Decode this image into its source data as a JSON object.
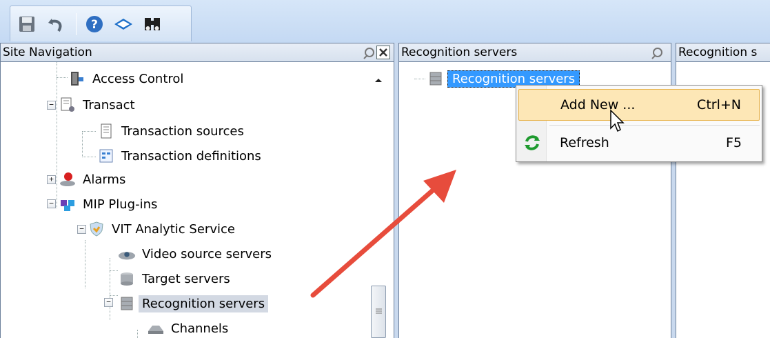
{
  "toolbar": {
    "buttons": [
      {
        "icon": "save-icon"
      },
      {
        "icon": "undo-icon"
      },
      {
        "icon": "help-icon"
      },
      {
        "icon": "book-icon"
      },
      {
        "icon": "binoculars-icon"
      }
    ]
  },
  "site_navigation": {
    "title": "Site Navigation",
    "tree": [
      {
        "label": "Access Control",
        "icon": "access-control-icon"
      },
      {
        "label": "Transact",
        "icon": "transact-icon",
        "expanded": true
      },
      {
        "label": "Transaction sources",
        "icon": "transaction-sources-icon"
      },
      {
        "label": "Transaction definitions",
        "icon": "transaction-definitions-icon"
      },
      {
        "label": "Alarms",
        "icon": "alarms-icon",
        "expanded": false
      },
      {
        "label": "MIP Plug-ins",
        "icon": "plugin-icon",
        "expanded": true
      },
      {
        "label": "VIT Analytic Service",
        "icon": "shield-icon",
        "expanded": true
      },
      {
        "label": "Video source servers",
        "icon": "camera-server-icon"
      },
      {
        "label": "Target servers",
        "icon": "server-icon"
      },
      {
        "label": "Recognition servers",
        "icon": "server-icon",
        "expanded": true,
        "selected": true
      },
      {
        "label": "Channels",
        "icon": "channel-icon"
      }
    ]
  },
  "recognition_pane": {
    "title": "Recognition servers",
    "root_label": "Recognition servers"
  },
  "third_pane": {
    "title": "Recognition s"
  },
  "context_menu": {
    "items": [
      {
        "label": "Add New ...",
        "shortcut": "Ctrl+N",
        "highlighted": true
      },
      {
        "label": "Refresh",
        "shortcut": "F5",
        "icon": "refresh-icon"
      }
    ]
  },
  "colors": {
    "selection": "#3399ff",
    "menu_highlight": "#fde7b6",
    "arrow": "#e74c3c"
  }
}
